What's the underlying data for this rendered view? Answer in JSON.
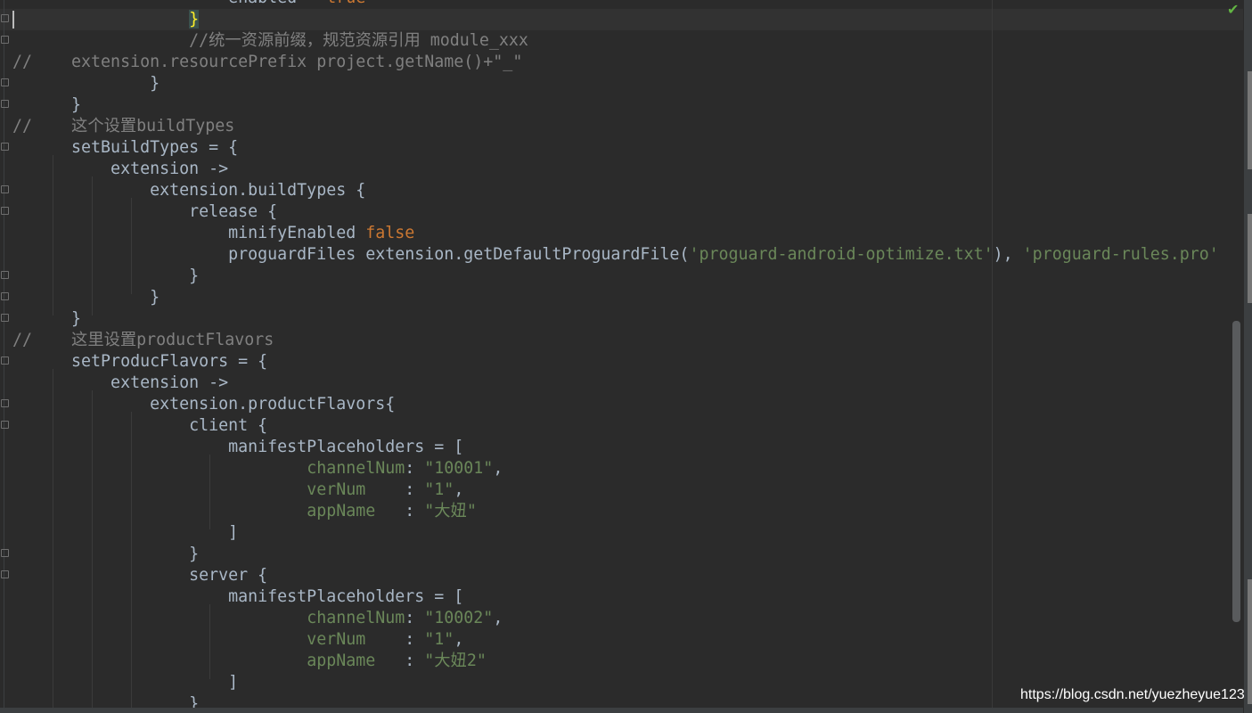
{
  "editor": {
    "lines": [
      {
        "text": "                      enabled = true"
      },
      {
        "text": "                  }"
      },
      {
        "text": "                  //统一资源前缀，规范资源引用 module_xxx"
      },
      {
        "text": "//    extension.resourcePrefix project.getName()+\"_\""
      },
      {
        "text": "              }"
      },
      {
        "text": "      }"
      },
      {
        "text": "//    这个设置buildTypes"
      },
      {
        "text": "      setBuildTypes = {"
      },
      {
        "text": "          extension ->"
      },
      {
        "text": "              extension.buildTypes {"
      },
      {
        "text": "                  release {"
      },
      {
        "text": "                      minifyEnabled false"
      },
      {
        "text": "                      proguardFiles extension.getDefaultProguardFile('proguard-android-optimize.txt'), 'proguard-rules.pro'"
      },
      {
        "text": "                  }"
      },
      {
        "text": "              }"
      },
      {
        "text": "      }"
      },
      {
        "text": "//    这里设置productFlavors"
      },
      {
        "text": "      setProducFlavors = {"
      },
      {
        "text": "          extension ->"
      },
      {
        "text": "              extension.productFlavors{"
      },
      {
        "text": "                  client {"
      },
      {
        "text": "                      manifestPlaceholders = ["
      },
      {
        "text": "                              channelNum: \"10001\","
      },
      {
        "text": "                              verNum    : \"1\","
      },
      {
        "text": "                              appName   : \"大妞\""
      },
      {
        "text": "                      ]"
      },
      {
        "text": "                  }"
      },
      {
        "text": "                  server {"
      },
      {
        "text": "                      manifestPlaceholders = ["
      },
      {
        "text": "                              channelNum: \"10002\","
      },
      {
        "text": "                              verNum    : \"1\","
      },
      {
        "text": "                              appName   : \"大妞2\""
      },
      {
        "text": "                      ]"
      },
      {
        "text": "                  }"
      }
    ]
  },
  "status": {
    "inspection_icon": "check-icon"
  },
  "watermark": "https://blog.csdn.net/yuezheyue123",
  "colors": {
    "background": "#2b2b2b",
    "default_text": "#a9b7c6",
    "comment": "#808080",
    "keyword": "#cc7832",
    "string": "#6a8759",
    "brace_highlight": "#ffef28"
  }
}
